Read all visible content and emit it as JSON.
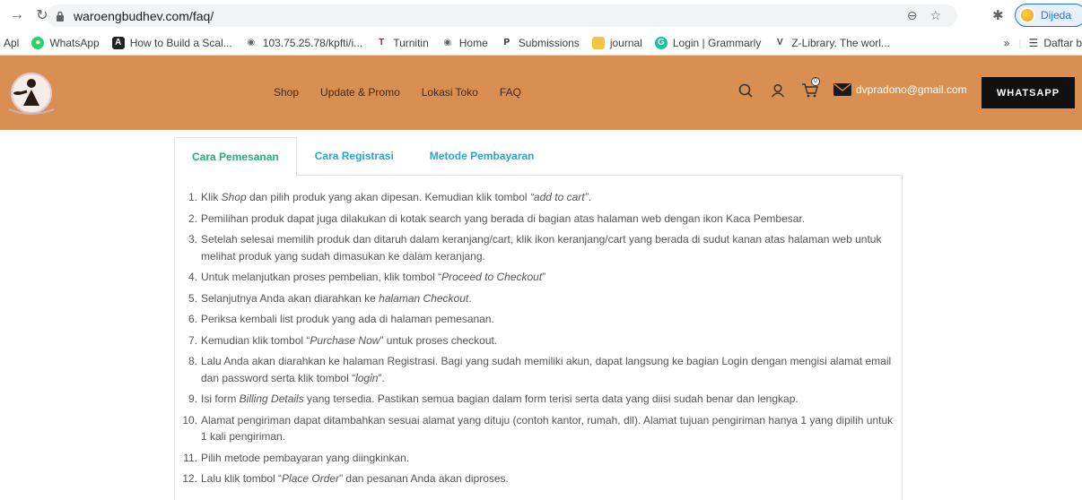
{
  "browser": {
    "url": "waroengbudhev.com/faq/",
    "profile_label": "Dijeda",
    "bookmarks": [
      {
        "label": "Apl",
        "icon": ""
      },
      {
        "label": "WhatsApp",
        "icon": "whatsapp-icon"
      },
      {
        "label": "How to Build a Scal...",
        "icon": "ad-icon"
      },
      {
        "label": "103.75.25.78/kpfti/i...",
        "icon": "globe-icon"
      },
      {
        "label": "Turnitin",
        "icon": "turnitin-icon"
      },
      {
        "label": "Home",
        "icon": "globe-icon"
      },
      {
        "label": "Submissions",
        "icon": "pkp-icon"
      },
      {
        "label": "journal",
        "icon": "folder-icon"
      },
      {
        "label": "Login | Grammarly",
        "icon": "grammarly-icon"
      },
      {
        "label": "Z-Library. The worl...",
        "icon": "zlibrary-icon"
      }
    ],
    "bookmarks_overflow": "»",
    "reading_list": "Daftar b"
  },
  "header": {
    "nav": [
      "Shop",
      "Update & Promo",
      "Lokasi Toko",
      "FAQ"
    ],
    "cart_count": "0",
    "email": "dvpradono@gmail.com",
    "whatsapp_label": "WHATSAPP",
    "colors": {
      "header_bg": "#d98f52",
      "button_bg": "#111111"
    }
  },
  "tabs": [
    {
      "label": "Cara Pemesanan",
      "active": true
    },
    {
      "label": "Cara Registrasi",
      "active": false
    },
    {
      "label": "Metode Pembayaran",
      "active": false
    }
  ],
  "steps": [
    {
      "n": "1.",
      "parts": [
        [
          "Klik ",
          false
        ],
        [
          "Shop",
          true
        ],
        [
          " dan pilih produk yang akan dipesan. Kemudian klik tombol ",
          false
        ],
        [
          "“add to cart”",
          true
        ],
        [
          ".",
          false
        ]
      ]
    },
    {
      "n": "2.",
      "parts": [
        [
          "Pemilihan produk dapat juga dilakukan di kotak search yang berada di bagian atas halaman web dengan ikon Kaca Pembesar.",
          false
        ]
      ]
    },
    {
      "n": "3.",
      "parts": [
        [
          "Setelah selesai memilih produk dan ditaruh dalam keranjang/cart, klik ikon keranjang/cart yang berada di sudut kanan atas halaman web untuk melihat produk yang sudah dimasukan ke dalam keranjang.",
          false
        ]
      ]
    },
    {
      "n": "4.",
      "parts": [
        [
          "Untuk melanjutkan proses pembelian, klik tombol “",
          false
        ],
        [
          "Proceed to Checkout",
          true
        ],
        [
          "”",
          false
        ]
      ]
    },
    {
      "n": "5.",
      "parts": [
        [
          "Selanjutnya Anda akan diarahkan ke ",
          false
        ],
        [
          "halaman Checkout",
          true
        ],
        [
          ".",
          false
        ]
      ]
    },
    {
      "n": "6.",
      "parts": [
        [
          "Periksa kembali list produk yang ada di halaman pemesanan.",
          false
        ]
      ]
    },
    {
      "n": "7.",
      "parts": [
        [
          "Kemudian klik tombol “",
          false
        ],
        [
          "Purchase Now",
          true
        ],
        [
          "” untuk proses checkout.",
          false
        ]
      ]
    },
    {
      "n": "8.",
      "parts": [
        [
          "Lalu Anda akan diarahkan ke halaman Registrasi. Bagi yang sudah memiliki akun, dapat langsung ke bagian Login dengan mengisi alamat email dan password serta klik tombol “",
          false
        ],
        [
          "login",
          true
        ],
        [
          "”.",
          false
        ]
      ]
    },
    {
      "n": "9.",
      "parts": [
        [
          "Isi form ",
          false
        ],
        [
          "Billing Details",
          true
        ],
        [
          " yang tersedia. Pastikan semua bagian dalam form terisi serta data yang diisi sudah benar dan lengkap.",
          false
        ]
      ]
    },
    {
      "n": "10.",
      "parts": [
        [
          "Alamat pengiriman dapat ditambahkan sesuai alamat yang dituju (contoh kantor, rumah, dll). Alamat tujuan pengiriman hanya 1 yang dipilih untuk 1 kali pengiriman.",
          false
        ]
      ]
    },
    {
      "n": "11.",
      "parts": [
        [
          "Pilih metode pembayaran yang diingkinkan.",
          false
        ]
      ]
    },
    {
      "n": "12.",
      "parts": [
        [
          "Lalu klik tombol “",
          false
        ],
        [
          "Place Order",
          true
        ],
        [
          "” dan pesanan Anda akan diproses.",
          false
        ]
      ]
    }
  ]
}
